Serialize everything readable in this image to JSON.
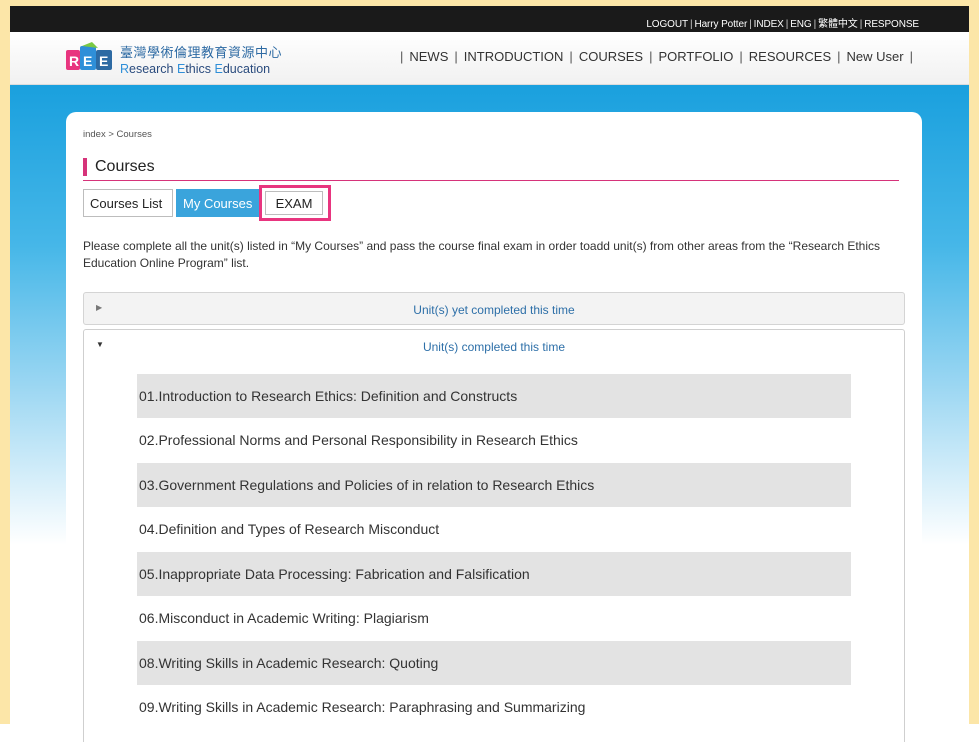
{
  "topbar": {
    "logout": "LOGOUT",
    "user": "Harry Potter",
    "index": "INDEX",
    "eng": "ENG",
    "chinese": "繁體中文",
    "response": "RESPONSE"
  },
  "logo": {
    "cn": "臺灣學術倫理教育資源中心",
    "en_r": "R",
    "en_research": "esearch ",
    "en_e1": "E",
    "en_ethics": "thics ",
    "en_e2": "E",
    "en_education": "ducation"
  },
  "nav": [
    "NEWS",
    "INTRODUCTION",
    "COURSES",
    "PORTFOLIO",
    "RESOURCES",
    "New User"
  ],
  "breadcrumb": "index > Courses",
  "page_title": "Courses",
  "tabs": {
    "list": "Courses List",
    "mine": "My Courses",
    "exam": "EXAM"
  },
  "note": "Please complete all the unit(s) listed in “My Courses” and pass the course final exam in order toadd unit(s) from other areas from the “Research Ethics Education Online Program” list.",
  "accordion": {
    "pending": "Unit(s) yet completed this time",
    "completed": "Unit(s) completed this time"
  },
  "courses": [
    "01.Introduction to Research Ethics: Definition and Constructs",
    "02.Professional Norms and Personal Responsibility in Research Ethics",
    "03.Government Regulations and Policies of in relation to Research Ethics",
    "04.Definition and Types of Research Misconduct",
    "05.Inappropriate Data Processing: Fabrication and Falsification",
    "06.Misconduct in Academic Writing: Plagiarism",
    "08.Writing Skills in Academic Research: Quoting",
    "09.Writing Skills in Academic Research: Paraphrasing and Summarizing"
  ],
  "colors": {
    "accent_pink": "#e8357f",
    "tab_blue": "#3aa4dc",
    "link_blue": "#2d6fa8"
  }
}
